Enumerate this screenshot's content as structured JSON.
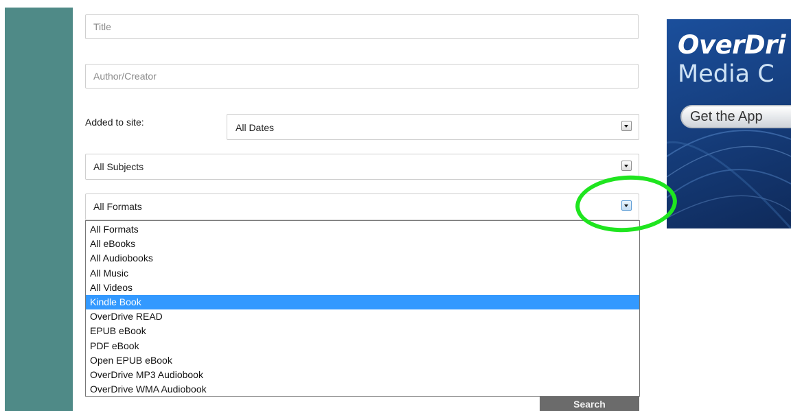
{
  "form": {
    "title_placeholder": "Title",
    "author_placeholder": "Author/Creator",
    "added_label": "Added to site:",
    "dates_value": "All Dates",
    "subjects_value": "All Subjects",
    "formats_value": "All Formats",
    "format_options": [
      "All Formats",
      "All eBooks",
      "All Audiobooks",
      "All Music",
      "All Videos",
      "Kindle Book",
      "OverDrive READ",
      "EPUB eBook",
      "PDF eBook",
      "Open EPUB eBook",
      "OverDrive MP3 Audiobook",
      "OverDrive WMA Audiobook"
    ],
    "highlighted_option": "Kindle Book",
    "search_label": "Search"
  },
  "ad": {
    "brand": "OverDri",
    "subtitle": "Media C",
    "cta": "Get the App"
  },
  "colors": {
    "sidebar": "#4f8a87",
    "highlight": "#3399ff",
    "ring": "#1fe51f",
    "button": "#6b6b6b"
  }
}
